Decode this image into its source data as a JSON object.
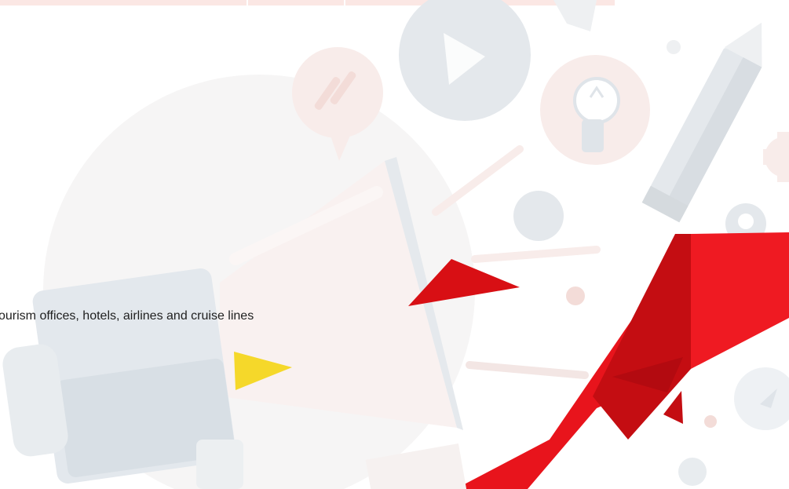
{
  "slide": {
    "body_text": "ourism offices, hotels, airlines and cruise lines"
  },
  "top_tabs": {
    "count": 4
  },
  "illustration": {
    "name": "marketing-megaphone-illustration",
    "icons": [
      "megaphone-icon",
      "play-icon",
      "lightbulb-icon",
      "pencil-icon",
      "speech-bubble-icon",
      "gear-icon",
      "location-pin-icon",
      "compass-icon"
    ],
    "colors": {
      "ribbon_red": "#e8141c",
      "ribbon_dark_red": "#c40d12",
      "accent_yellow": "#f5d82a",
      "soft_gray_blue": "#dfe4e9",
      "soft_pink": "#f8ecea"
    }
  }
}
